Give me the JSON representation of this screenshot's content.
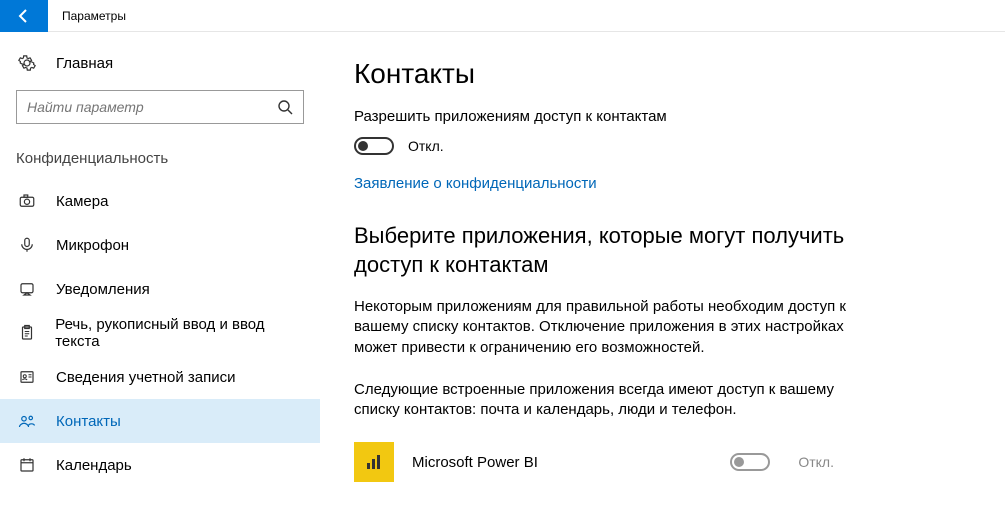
{
  "window": {
    "title": "Параметры"
  },
  "sidebar": {
    "home_label": "Главная",
    "search_placeholder": "Найти параметр",
    "section_label": "Конфиденциальность",
    "items": [
      {
        "label": "Камера"
      },
      {
        "label": "Микрофон"
      },
      {
        "label": "Уведомления"
      },
      {
        "label": "Речь, рукописный ввод и ввод текста"
      },
      {
        "label": "Сведения учетной записи"
      },
      {
        "label": "Контакты"
      },
      {
        "label": "Календарь"
      }
    ]
  },
  "main": {
    "title": "Контакты",
    "allow_label": "Разрешить приложениям доступ к контактам",
    "allow_state_label": "Откл.",
    "privacy_link": "Заявление о конфиденциальности",
    "choose_title": "Выберите приложения, которые могут получить доступ к контактам",
    "para1": "Некоторым приложениям для правильной работы необходим доступ к вашему списку контактов. Отключение приложения в этих настройках может привести к ограничению его возможностей.",
    "para2": "Следующие встроенные приложения всегда имеют доступ к вашему списку контактов: почта и календарь, люди и телефон.",
    "apps": [
      {
        "name": "Microsoft Power BI",
        "state_label": "Откл."
      }
    ]
  }
}
